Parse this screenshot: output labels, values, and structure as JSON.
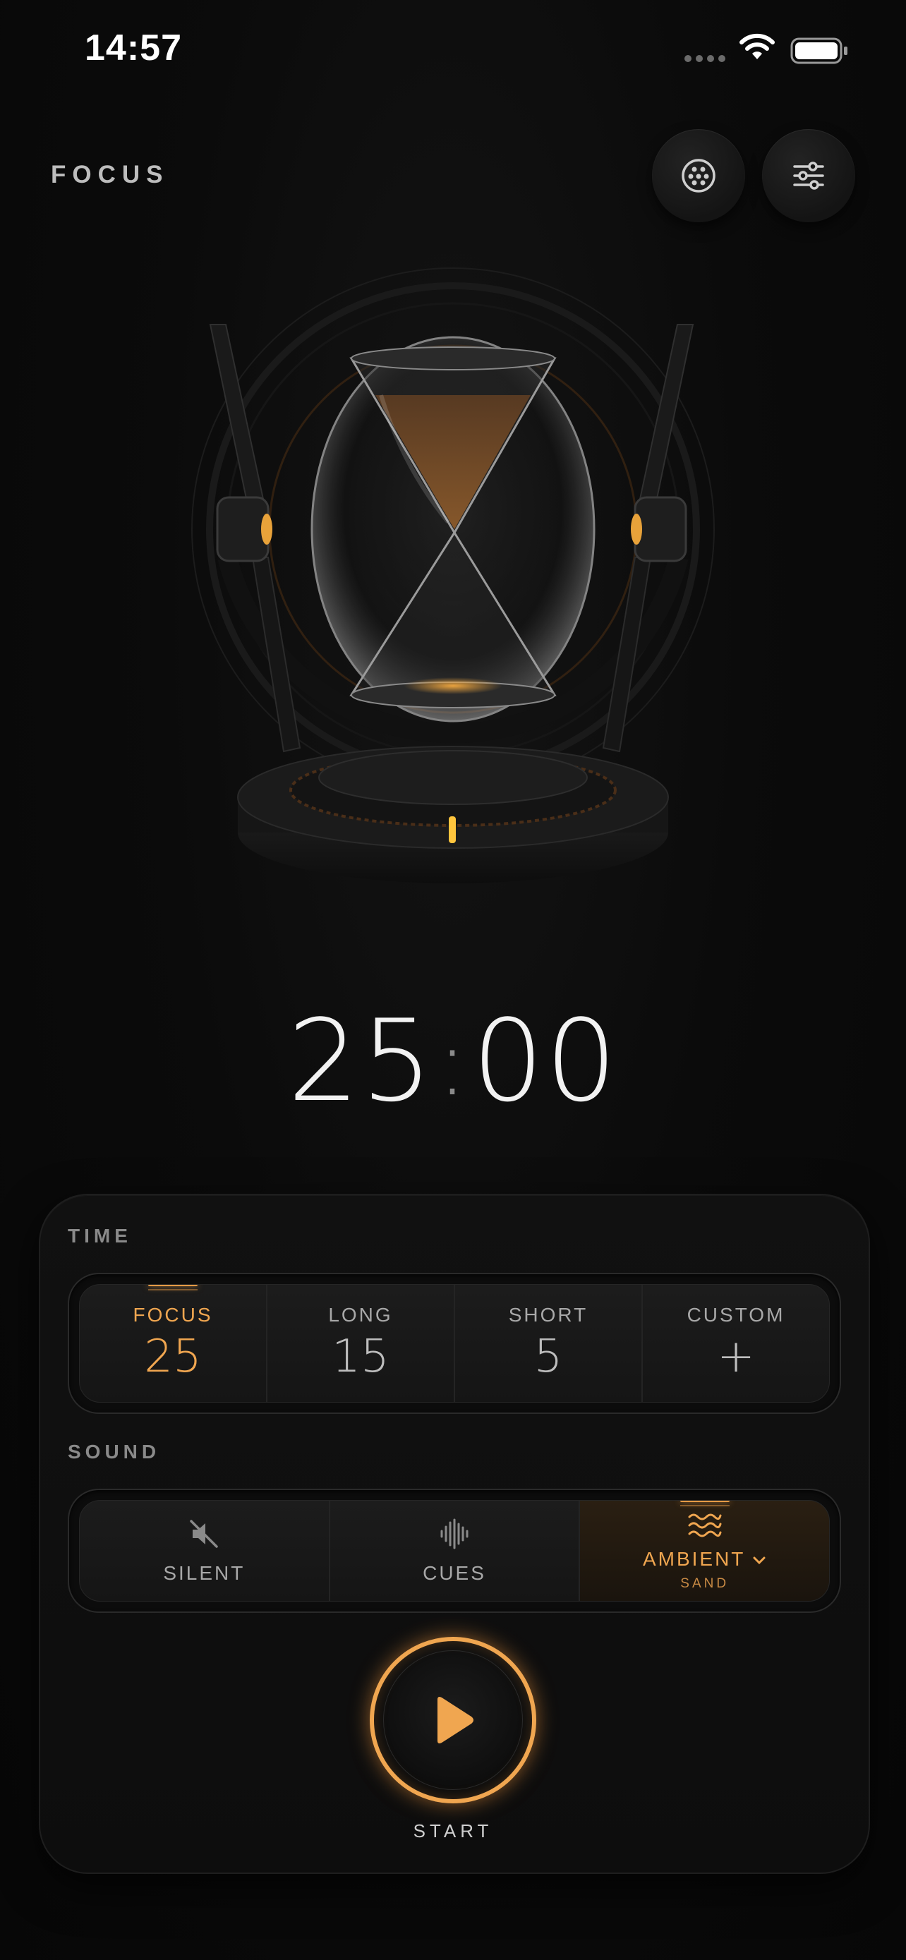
{
  "status_bar": {
    "time": "14:57"
  },
  "header": {
    "title": "FOCUS"
  },
  "timer": {
    "minutes": "25",
    "separator": ":",
    "seconds": "00"
  },
  "time_section": {
    "label": "TIME",
    "options": [
      {
        "title": "FOCUS",
        "value": "25",
        "active": true
      },
      {
        "title": "LONG",
        "value": "15",
        "active": false
      },
      {
        "title": "SHORT",
        "value": "5",
        "active": false
      },
      {
        "title": "CUSTOM",
        "value": "+",
        "active": false
      }
    ]
  },
  "sound_section": {
    "label": "SOUND",
    "options": [
      {
        "title": "SILENT",
        "icon": "speaker-muted-icon",
        "active": false
      },
      {
        "title": "CUES",
        "icon": "waveform-icon",
        "active": false
      },
      {
        "title": "AMBIENT",
        "subtitle": "SAND",
        "icon": "waves-icon",
        "active": true
      }
    ]
  },
  "start": {
    "label": "START"
  },
  "colors": {
    "accent": "#f0a650",
    "background": "#0b0b0b"
  }
}
